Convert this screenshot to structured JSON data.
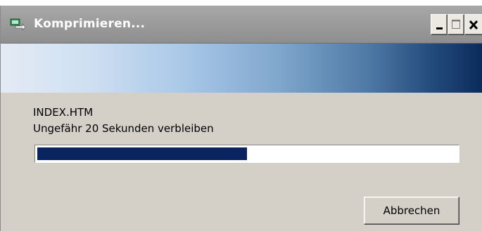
{
  "window": {
    "title": "Komprimieren...",
    "icon": "compress-files-icon",
    "controls": {
      "minimize": "minimize-icon",
      "maximize": "maximize-icon",
      "close": "close-icon"
    }
  },
  "status": {
    "filename": "INDEX.HTM",
    "time_remaining": "Ungefähr 20 Sekunden verbleiben"
  },
  "progress": {
    "fraction": 0.5
  },
  "buttons": {
    "cancel_label": "Abbrechen"
  },
  "colors": {
    "progress_fill": "#0a2462",
    "banner_dark": "#0a2b5c",
    "banner_light": "#e3ebf5"
  }
}
